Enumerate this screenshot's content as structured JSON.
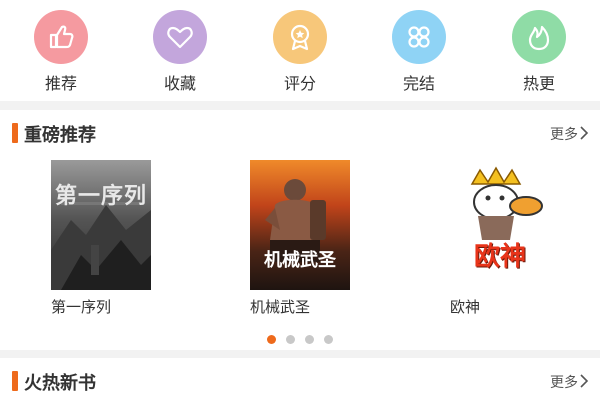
{
  "categories": [
    {
      "label": "推荐",
      "icon": "thumbs-up-icon",
      "color": "#f59aa0"
    },
    {
      "label": "收藏",
      "icon": "heart-icon",
      "color": "#c3a6dc"
    },
    {
      "label": "评分",
      "icon": "award-medal-icon",
      "color": "#f7c77a"
    },
    {
      "label": "完结",
      "icon": "clover-grid-icon",
      "color": "#8fd3f5"
    },
    {
      "label": "热更",
      "icon": "flame-icon",
      "color": "#8fdca6"
    }
  ],
  "sections": {
    "featured": {
      "title": "重磅推荐",
      "more": "更多",
      "books": [
        {
          "title": "第一序列",
          "cover_text": "第一序列"
        },
        {
          "title": "机械武圣",
          "cover_text": "机械武圣"
        },
        {
          "title": "欧神",
          "cover_text": "欧神"
        }
      ],
      "carousel": {
        "pages": 4,
        "active_index": 0
      }
    },
    "hot_new": {
      "title": "火热新书",
      "more": "更多"
    }
  },
  "colors": {
    "accent": "#ee6a1c",
    "background": "#f2f2f2",
    "text": "#333333"
  }
}
